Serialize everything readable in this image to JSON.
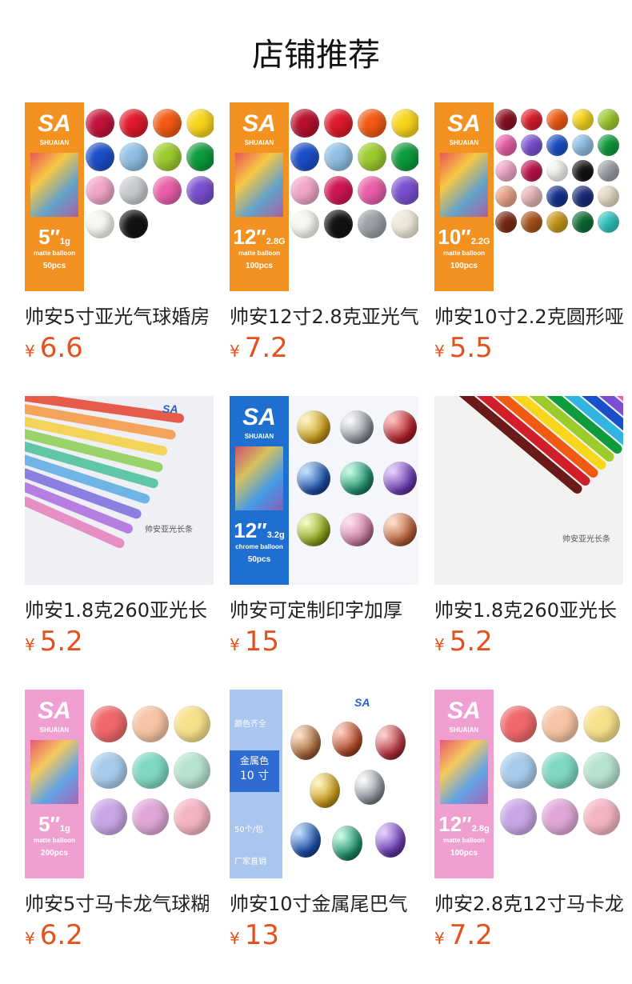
{
  "header": {
    "title": "店铺推荐"
  },
  "currency": "¥",
  "products": [
    {
      "name": "帅安5寸亚光气球婚房",
      "price": "6.6",
      "image": "sa-5inch-matte-50pcs"
    },
    {
      "name": "帅安12寸2.8克亚光气",
      "price": "7.2",
      "image": "sa-12inch-matte-100pcs"
    },
    {
      "name": "帅安10寸2.2克圆形哑",
      "price": "5.5",
      "image": "sa-10inch-matte-100pcs"
    },
    {
      "name": "帅安1.8克260亚光长",
      "price": "5.2",
      "image": "long-balloons-pastel"
    },
    {
      "name": "帅安可定制印字加厚",
      "price": "15",
      "image": "sa-12inch-chrome-50pcs"
    },
    {
      "name": "帅安1.8克260亚光长",
      "price": "5.2",
      "image": "long-balloons-rainbow"
    },
    {
      "name": "帅安5寸马卡龙气球糊",
      "price": "6.2",
      "image": "sa-5inch-macaron-200pcs"
    },
    {
      "name": "帅安10寸金属尾巴气",
      "price": "13",
      "image": "metal-tail-balloons"
    },
    {
      "name": "帅安2.8克12寸马卡龙",
      "price": "7.2",
      "image": "sa-12inch-macaron-100pcs"
    }
  ],
  "images": {
    "brand_logo": "SA",
    "brand_name": "SHUAIAN",
    "p1": {
      "size": "5",
      "weight": "1g",
      "kind": "matte balloon",
      "pcs": "50pcs"
    },
    "p2": {
      "size": "12",
      "weight": "2.8G",
      "kind": "matte balloon",
      "pcs": "100pcs"
    },
    "p3": {
      "size": "10",
      "weight": "2.2G",
      "kind": "matte balloon",
      "pcs": "100pcs"
    },
    "p5": {
      "size": "12",
      "weight": "3.2g",
      "kind": "chrome balloon",
      "pcs": "50pcs"
    },
    "p7": {
      "size": "5",
      "weight": "1g",
      "kind": "matte balloon",
      "pcs": "200pcs"
    },
    "p9": {
      "size": "12",
      "weight": "2.8g",
      "kind": "matte balloon",
      "pcs": "100pcs"
    },
    "sticks_caption": "帅安亚光长条",
    "sticks_caption2": "帅安亚光长条",
    "tail_color_label": "颜色齐全",
    "tail_badge1": "金属色",
    "tail_badge2": "10 寸",
    "tail_pack": "50个/包",
    "tail_factory": "厂家直销"
  },
  "colors": {
    "price": "#e5511d",
    "orange_panel": "#f39220",
    "pink_panel": "#ef9fd0"
  }
}
